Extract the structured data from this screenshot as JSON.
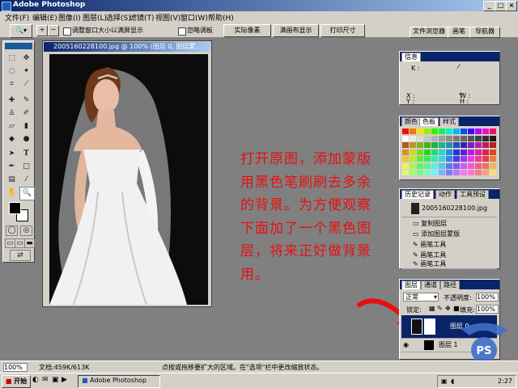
{
  "app": {
    "title": "Adobe Photoshop"
  },
  "menu": [
    "文件(F)",
    "编辑(E)",
    "图像(I)",
    "图层(L)",
    "选择(S)",
    "滤镜(T)",
    "视图(V)",
    "窗口(W)",
    "帮助(H)"
  ],
  "options": {
    "resize_label": "调整窗口大小以满屏显示",
    "ignore_label": "忽略调板",
    "actual_pixels": "实际像素",
    "fit_screen": "满画布显示",
    "print_size": "打印尺寸"
  },
  "palette_well": [
    "文件浏览器",
    "画笔",
    "导航器"
  ],
  "document": {
    "title": "2005160228100.jpg @ 100% (图层 0, 图层蒙..."
  },
  "annotation": [
    "打开原图，添加蒙版",
    "用黑色笔刷刷去多余",
    "的背景。为方便观察",
    "下面加了一个黑色图",
    "层，将来正好做背景",
    "用。"
  ],
  "info_panel": {
    "tab": "信息",
    "k": "K :",
    "x": "X :",
    "y": "Y :",
    "w": "W :",
    "h": "H :"
  },
  "swatches_panel": {
    "tabs": [
      "颜色",
      "色板",
      "样式"
    ]
  },
  "history_panel": {
    "tabs": [
      "历史记录",
      "动作",
      "工具预设"
    ],
    "snapshot": "2005160228100.jpg",
    "items": [
      "复制图层",
      "添加图层蒙版",
      "画笔工具",
      "画笔工具",
      "画笔工具"
    ]
  },
  "layers_panel": {
    "tabs": [
      "图层",
      "通道",
      "路径"
    ],
    "blend_mode": "正常",
    "opacity_label": "不透明度:",
    "opacity": "100%",
    "lock_label": "锁定:",
    "fill_label": "填充:",
    "fill": "100%",
    "layers": [
      "图层 0",
      "图层 1"
    ]
  },
  "status": {
    "zoom": "100%",
    "doc_size": "文档:459K/613K",
    "hint": "点按或拖移要扩大的区域。在\"选项\"栏中更改缩放状态。"
  },
  "taskbar": {
    "start": "开始",
    "task": "Adobe Photoshop",
    "clock": "2:27"
  },
  "watermark": {
    "text": "PS"
  },
  "colors": {
    "title_blue": "#0a246a",
    "annotation_red": "#e61010",
    "arrow_red": "#e61010"
  }
}
